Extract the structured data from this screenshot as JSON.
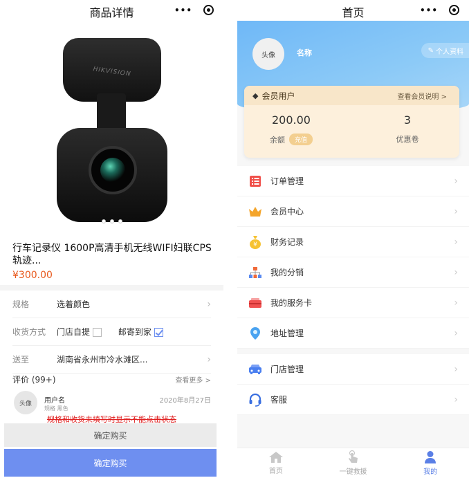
{
  "left": {
    "nav_title": "商品详情",
    "nav_dots": "•••",
    "product": {
      "brand_on_device": "HIKVISION",
      "title": "行车记录仪 1600P高清手机无线WIFI妇联CPS轨迹...",
      "price": "¥300.00"
    },
    "spec": {
      "label": "规格",
      "value": "选着颜色"
    },
    "delivery": {
      "label": "收货方式",
      "option1": "门店自提",
      "option2": "邮寄到家",
      "option2_checked": true
    },
    "ship_to": {
      "label": "送至",
      "value": "湖南省永州市冷水滩区..."
    },
    "reviews": {
      "title": "评价 (99+)",
      "more": "查看更多 >",
      "avatar": "头像",
      "user": "用户名",
      "spec": "规格 黑色",
      "date": "2020年8月27日"
    },
    "warning": "规格和收货未填写时显示不能点击状态",
    "buy_disabled": "确定购买",
    "buy_enabled": "确定购买"
  },
  "right": {
    "nav_title": "首页",
    "nav_dots": "•••",
    "avatar": "头像",
    "user_name": "名称",
    "profile_button": "个人资料",
    "member_level": "会员用户",
    "member_link": "查看会员说明 >",
    "balance": {
      "value": "200.00",
      "label": "余额",
      "action": "充值"
    },
    "coupons": {
      "value": "3",
      "label": "优惠卷"
    },
    "menu": [
      {
        "label": "订单管理",
        "icon": "order-list-icon",
        "color": "#f0504a"
      },
      {
        "label": "会员中心",
        "icon": "crown-icon",
        "color": "#f4a52b"
      },
      {
        "label": "财务记录",
        "icon": "money-bag-icon",
        "color": "#f6c233"
      },
      {
        "label": "我的分销",
        "icon": "org-chart-icon",
        "color": "#f06a3a"
      },
      {
        "label": "我的服务卡",
        "icon": "service-card-icon",
        "color": "#f05050"
      },
      {
        "label": "地址管理",
        "icon": "location-pin-icon",
        "color": "#4aa3f0"
      },
      {
        "label": "门店管理",
        "icon": "store-car-icon",
        "color": "#4a7ff0"
      },
      {
        "label": "客服",
        "icon": "headset-icon",
        "color": "#3a6fe0"
      }
    ],
    "tabs": [
      {
        "label": "首页",
        "icon": "home-icon",
        "active": false
      },
      {
        "label": "一键救援",
        "icon": "tap-hand-icon",
        "active": false
      },
      {
        "label": "我的",
        "icon": "user-icon",
        "active": true
      }
    ]
  }
}
